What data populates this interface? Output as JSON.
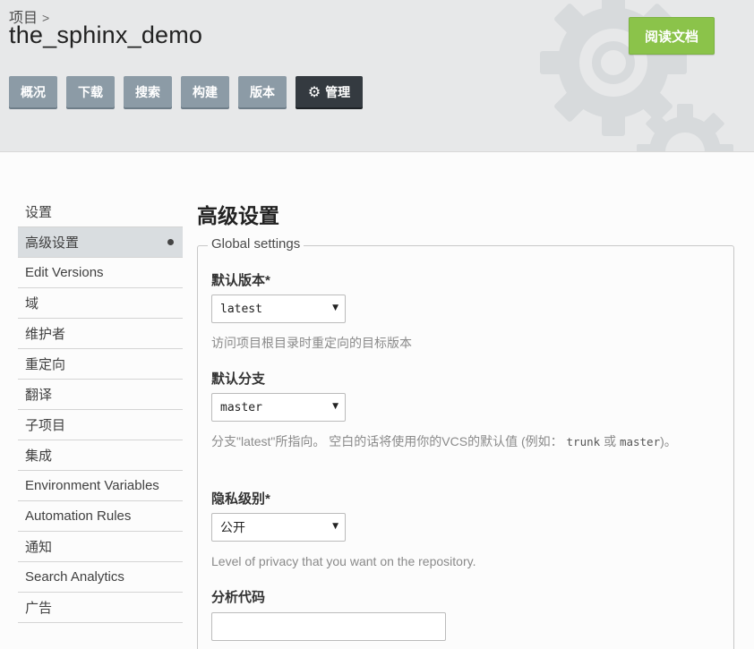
{
  "header": {
    "breadcrumb": "项目",
    "breadcrumb_sep": ">",
    "project_title": "the_sphinx_demo",
    "read_docs_label": "阅读文档",
    "tabs": [
      {
        "label": "概况"
      },
      {
        "label": "下载"
      },
      {
        "label": "搜索"
      },
      {
        "label": "构建"
      },
      {
        "label": "版本"
      },
      {
        "label": "管理",
        "icon": "gear-icon",
        "active": true
      }
    ]
  },
  "sidebar": {
    "items": [
      {
        "label": "设置"
      },
      {
        "label": "高级设置",
        "active": true
      },
      {
        "label": "Edit Versions"
      },
      {
        "label": "域"
      },
      {
        "label": "维护者"
      },
      {
        "label": "重定向"
      },
      {
        "label": "翻译"
      },
      {
        "label": "子项目"
      },
      {
        "label": "集成"
      },
      {
        "label": "Environment Variables"
      },
      {
        "label": "Automation Rules"
      },
      {
        "label": "通知"
      },
      {
        "label": "Search Analytics"
      },
      {
        "label": "广告"
      }
    ]
  },
  "main": {
    "title": "高级设置",
    "fieldset_legend": "Global settings",
    "default_version": {
      "label": "默认版本*",
      "value": "latest",
      "help": "访问项目根目录时重定向的目标版本"
    },
    "default_branch": {
      "label": "默认分支",
      "value": "master",
      "help_part1": "分支\"latest\"所指向。 空白的话将使用你的VCS的默认值 (例如：",
      "help_code1": "trunk",
      "help_part2": "或",
      "help_code2": "master",
      "help_part3": ")。"
    },
    "privacy_level": {
      "label": "隐私级别*",
      "value": "公开",
      "help": "Level of privacy that you want on the repository."
    },
    "analytics_code": {
      "label": "分析代码",
      "value": ""
    }
  },
  "colors": {
    "read_docs_bg": "#8bc34a",
    "tab_bg": "#8c9ba6",
    "tab_active_bg": "#343a40",
    "header_bg": "#e7e8e9"
  }
}
